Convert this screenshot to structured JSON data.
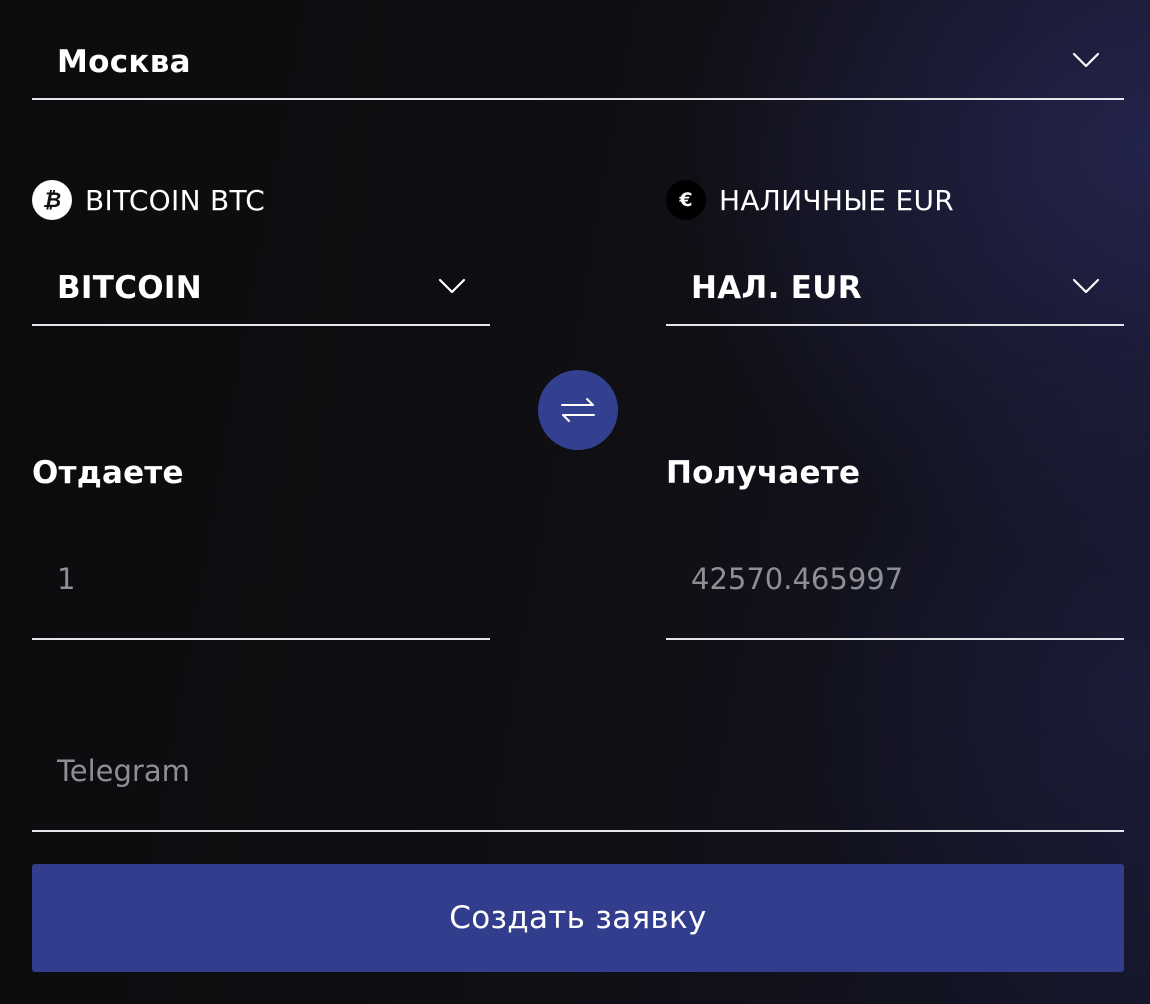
{
  "city": {
    "selected": "Москва"
  },
  "give": {
    "currency_label": "BITCOIN BTC",
    "selected": "BITCOIN",
    "title": "Отдаете",
    "amount_placeholder": "1"
  },
  "receive": {
    "currency_label": "НАЛИЧНЫЕ EUR",
    "selected": "НАЛ. EUR",
    "title": "Получаете",
    "amount_placeholder": "42570.465997",
    "currency_symbol": "€"
  },
  "contact": {
    "placeholder": "Telegram"
  },
  "submit": {
    "label": "Создать заявку"
  },
  "icons": {
    "btc": "bitcoin-icon",
    "eur": "euro-icon",
    "swap": "swap-arrows-icon",
    "chevron": "chevron-down-icon"
  },
  "colors": {
    "accent": "#333d8d",
    "swap_button": "#33408f",
    "underline": "#e6e6ea",
    "placeholder": "#8e8e95"
  }
}
